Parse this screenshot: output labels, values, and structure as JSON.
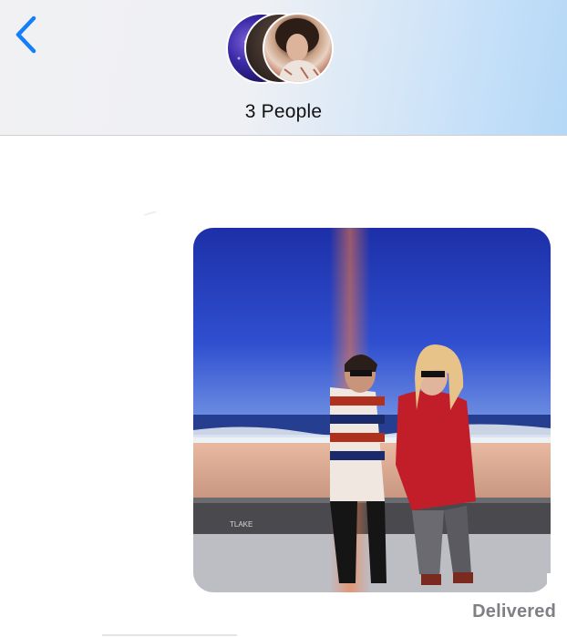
{
  "header": {
    "title": "3 People",
    "back_icon": "chevron-left-icon",
    "accent_color": "#147EFB"
  },
  "participants": [
    {
      "avatar": "avatar-1"
    },
    {
      "avatar": "avatar-2"
    },
    {
      "avatar": "avatar-3"
    }
  ],
  "messages": [
    {
      "type": "photo",
      "sender": "me",
      "description_icon": "photo-icon"
    }
  ],
  "status": {
    "label": "Delivered"
  }
}
